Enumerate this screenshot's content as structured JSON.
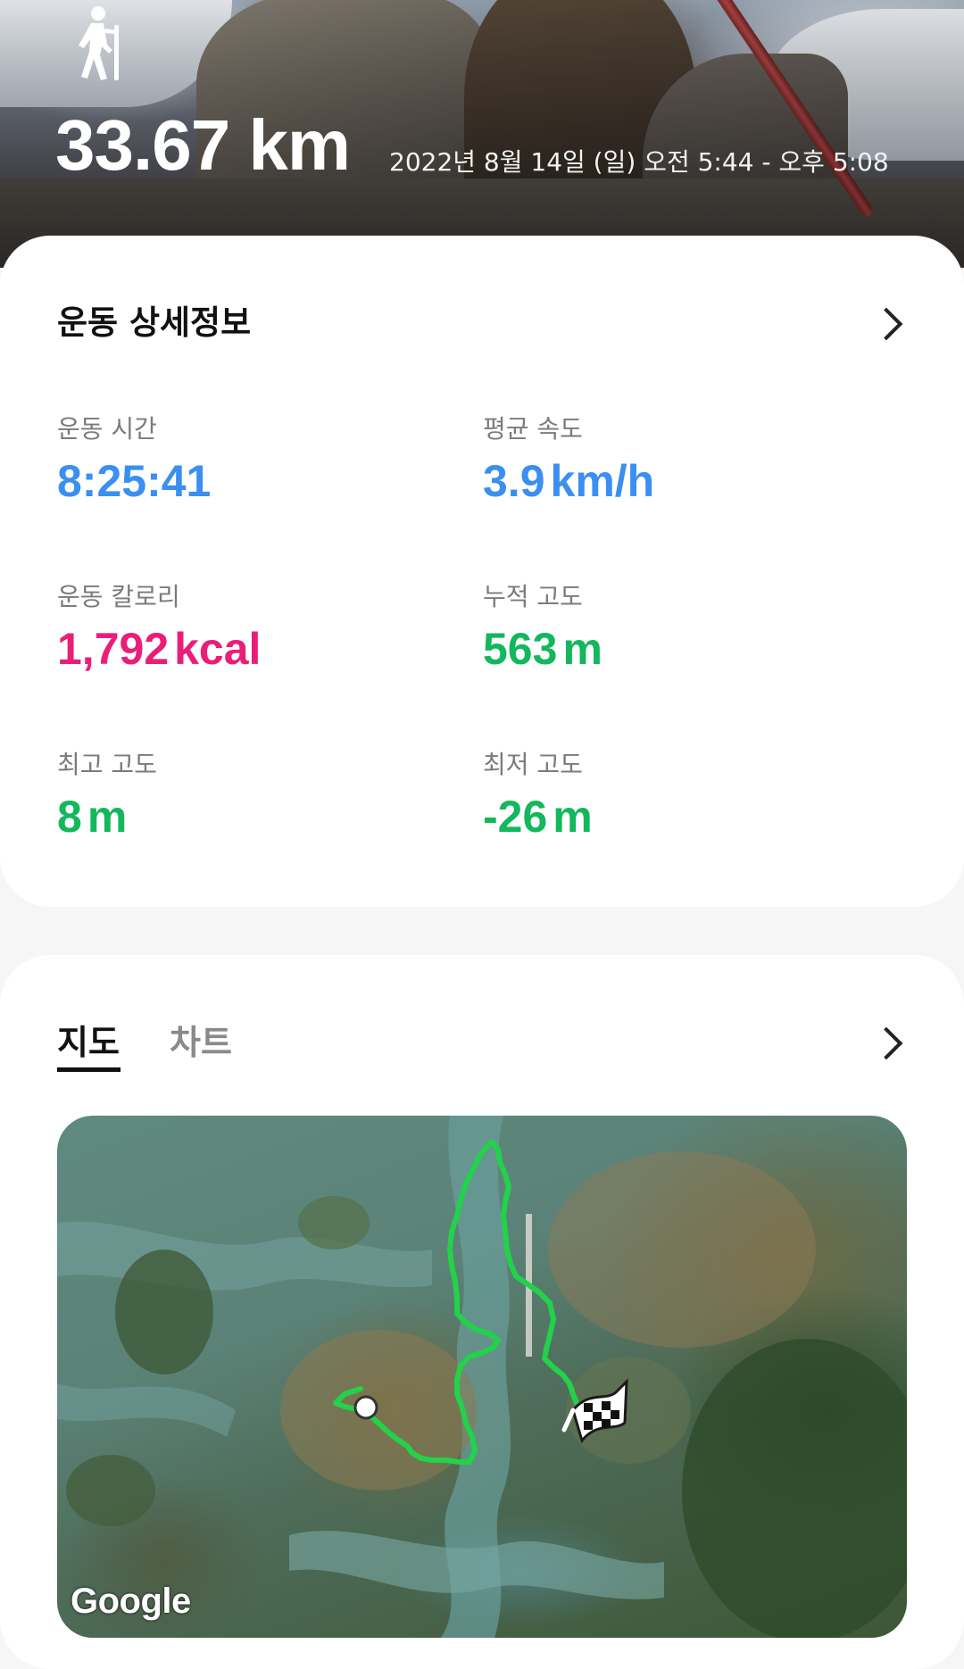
{
  "header": {
    "activity_icon": "hiking-icon",
    "distance": "33.67 km",
    "date_range": "2022년 8월 14일 (일) 오전 5:44 - 오후 5:08"
  },
  "details": {
    "title": "운동 상세정보",
    "chevron_icon": "chevron-right-icon",
    "stats": [
      {
        "label": "운동 시간",
        "value": "8:25:41",
        "unit": "",
        "color": "#3b8ff0"
      },
      {
        "label": "평균 속도",
        "value": "3.9",
        "unit": "km/h",
        "color": "#3b8ff0"
      },
      {
        "label": "운동 칼로리",
        "value": "1,792",
        "unit": "kcal",
        "color": "#ea1e78"
      },
      {
        "label": "누적 고도",
        "value": "563",
        "unit": "m",
        "color": "#13b75c"
      },
      {
        "label": "최고 고도",
        "value": "8",
        "unit": "m",
        "color": "#13b75c"
      },
      {
        "label": "최저 고도",
        "value": "-26",
        "unit": "m",
        "color": "#13b75c"
      }
    ]
  },
  "map_section": {
    "tabs": [
      {
        "label": "지도",
        "selected": true
      },
      {
        "label": "차트",
        "selected": false
      }
    ],
    "chevron_icon": "chevron-right-icon",
    "map_attribution": "Google",
    "route_color": "#22d24a",
    "start_marker_icon": "start-point-icon",
    "finish_marker_icon": "checkered-flag-icon"
  }
}
